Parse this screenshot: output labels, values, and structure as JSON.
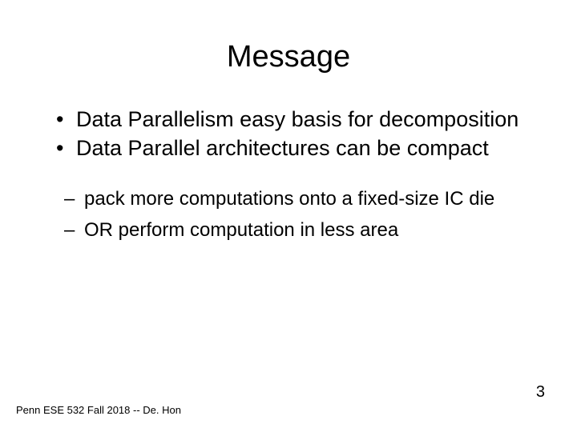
{
  "title": "Message",
  "bullets": [
    "Data Parallelism easy basis for decomposition",
    "Data Parallel architectures can be compact"
  ],
  "subbullets": [
    " pack more computations onto a fixed-size IC die",
    "OR perform computation in less area"
  ],
  "footer": "Penn ESE 532 Fall 2018 -- De. Hon",
  "page_number": "3"
}
